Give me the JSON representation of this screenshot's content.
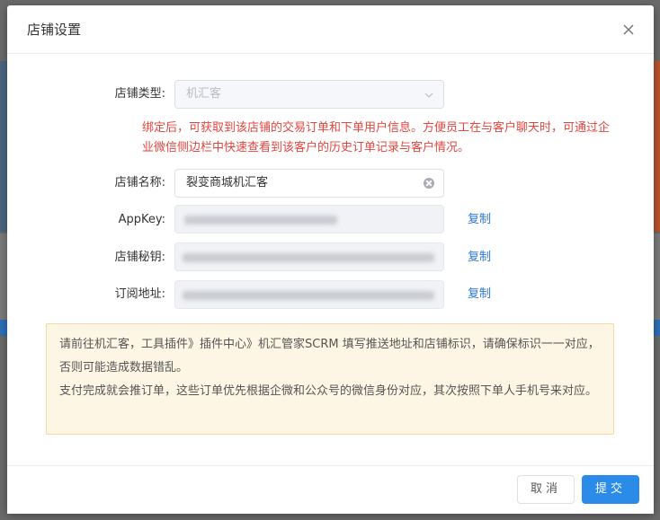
{
  "modal": {
    "title": "店铺设置",
    "close_icon": "close-icon"
  },
  "form": {
    "store_type": {
      "label": "店铺类型:",
      "value": "机汇客"
    },
    "notice": "绑定后，可获取到该店铺的交易订单和下单用户信息。方便员工在与客户聊天时，可通过企业微信侧边栏中快速查看到该客户的历史订单记录与客户情况。",
    "store_name": {
      "label": "店铺名称:",
      "value": "裂变商城机汇客"
    },
    "appkey": {
      "label": "AppKey:",
      "copy": "复制"
    },
    "store_secret": {
      "label": "店铺秘钥:",
      "copy": "复制"
    },
    "subscribe_url": {
      "label": "订阅地址:",
      "copy": "复制"
    }
  },
  "info": {
    "line1": "请前往机汇客，工具插件》插件中心》机汇管家SCRM 填写推送地址和店铺标识，请确保标识一一对应，否则可能造成数据错乱。",
    "line2": "支付完成就会推订单，这些订单优先根据企微和公众号的微信身份对应，其次按照下单人手机号来对应。"
  },
  "footer": {
    "cancel": "取消",
    "submit": "提交"
  },
  "colors": {
    "accent": "#2b8be8",
    "link": "#2b78d6",
    "warning_text": "#e4463f",
    "info_bg": "#fdf6e4"
  }
}
